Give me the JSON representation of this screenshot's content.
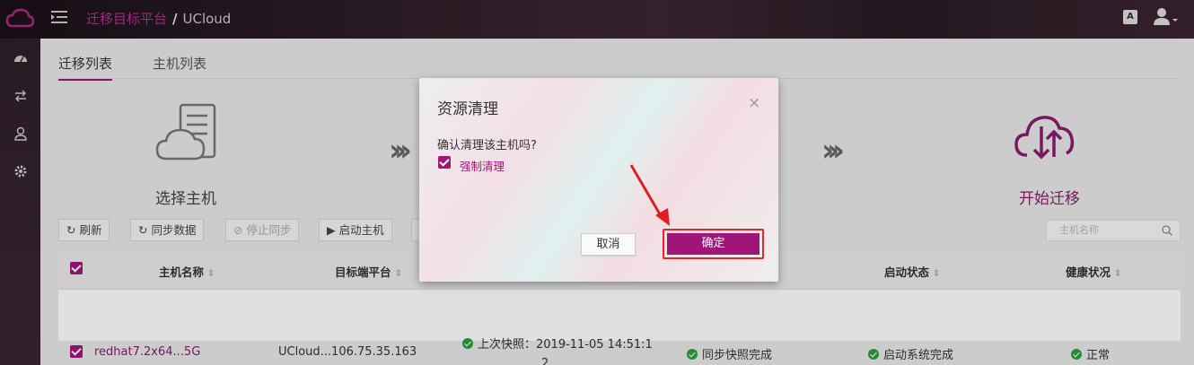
{
  "header": {
    "breadcrumb_current": "迁移目标平台",
    "breadcrumb_sep": "/",
    "breadcrumb_target": "UCloud",
    "translate_label": "A"
  },
  "tabs": [
    {
      "label": "迁移列表",
      "active": true
    },
    {
      "label": "主机列表",
      "active": false
    }
  ],
  "steps": {
    "select_host": "选择主机",
    "start_migrate": "开始迁移"
  },
  "toolbar": {
    "refresh": "刷新",
    "sync_data": "同步数据",
    "stop_sync": "停止同步",
    "start_host": "启动主机",
    "search_placeholder": "主机名称"
  },
  "table": {
    "headers": {
      "host_name": "主机名称",
      "target_platform": "目标端平台",
      "start_status": "启动状态",
      "health_status": "健康状况"
    },
    "rows": [
      {
        "host_name": "redhat7.2x64...5G",
        "target_platform": "UCloud...106.75.35.163",
        "snapshot_line1": "上次快照：2019-11-05 14:51:1",
        "snapshot_line2": "2",
        "sync_status": "同步快照完成",
        "start_status": "启动系统完成",
        "health_status": "正常"
      }
    ]
  },
  "modal": {
    "title": "资源清理",
    "close": "×",
    "message": "确认清理该主机吗?",
    "force_label": "强制清理",
    "force_checked": true,
    "cancel": "取消",
    "confirm": "确定"
  },
  "colors": {
    "accent": "#a0157a",
    "success": "#2e9e3e",
    "highlight": "#e02828"
  }
}
